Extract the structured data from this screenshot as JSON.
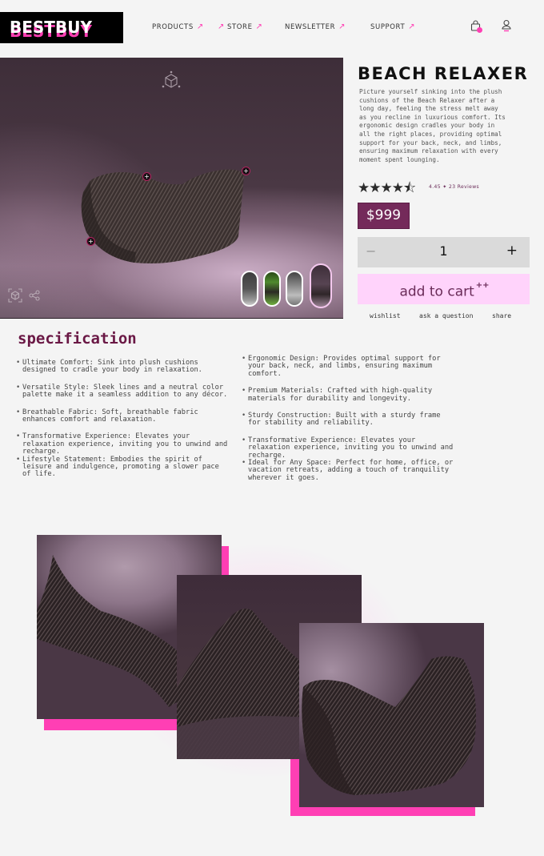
{
  "header": {
    "logo": "BESTBUY",
    "nav": [
      {
        "label": "PRODUCTS",
        "arrow_before": false
      },
      {
        "label": "STORE",
        "arrow_before": true
      },
      {
        "label": "NEWSLETTER",
        "arrow_before": false
      },
      {
        "label": "SUPPORT",
        "arrow_before": false
      }
    ],
    "arrow_glyph": "↗",
    "cart_icon": "shopping-bag-icon",
    "user_icon": "user-icon",
    "cart_badge_color": "#ff3fb4"
  },
  "hero": {
    "icons": [
      "3d-cube-icon",
      "ar-view-icon",
      "share-icon"
    ],
    "hotspot_glyph": "+",
    "thumbnails": [
      {
        "name": "gray-variant",
        "active": false
      },
      {
        "name": "green-variant",
        "active": false
      },
      {
        "name": "light-gray-variant",
        "active": false
      },
      {
        "name": "mauve-variant",
        "active": true
      }
    ]
  },
  "product": {
    "title": "BEACH RELAXER",
    "description": "Picture yourself sinking into the plush cushions of the Beach Relaxer after a long day, feeling the stress melt away as you recline in luxurious comfort. Its ergonomic design cradles your body in all the right places, providing optimal support for your back, neck, and limbs, ensuring maximum relaxation with every moment spent lounging.",
    "stars": "★★★★⯪",
    "rating_value": 4.45,
    "rating_text": "4.45 ✦ 23 Reviews",
    "price": "$999",
    "quantity": "1",
    "minus": "−",
    "plus": "+",
    "add_to_cart": "add to cart",
    "add_to_cart_badge": "++",
    "links": [
      "wishlist",
      "ask a question",
      "share"
    ],
    "accent_color": "#742a5a",
    "cart_button_color": "#ffd3fb"
  },
  "specification": {
    "title": "specification",
    "left": [
      "Ultimate Comfort: Sink into plush cushions designed to cradle your body in relaxation.",
      "Versatile Style: Sleek lines and a neutral color palette make it a seamless addition to any décor.",
      "Breathable Fabric: Soft, breathable fabric enhances comfort and relaxation.",
      "Transformative Experience: Elevates your relaxation experience, inviting you to unwind and recharge.",
      "Lifestyle Statement: Embodies the spirit of leisure and indulgence, promoting a slower pace of life."
    ],
    "right": [
      "Ergonomic Design: Provides optimal support for your back, neck, and limbs, ensuring maximum comfort.",
      "Premium Materials: Crafted with high-quality materials for durability and longevity.",
      "Sturdy Construction: Built with a sturdy frame for stability and reliability.",
      "Transformative Experience: Elevates your relaxation experience, inviting you to unwind and recharge.",
      "Ideal for Any Space: Perfect for home, office, or vacation retreats, adding a touch of tranquility wherever it goes."
    ]
  },
  "gallery": {
    "images": [
      "chair-detail-side",
      "chair-detail-back",
      "chair-full-view"
    ],
    "accent_color": "#ff3fb4"
  }
}
